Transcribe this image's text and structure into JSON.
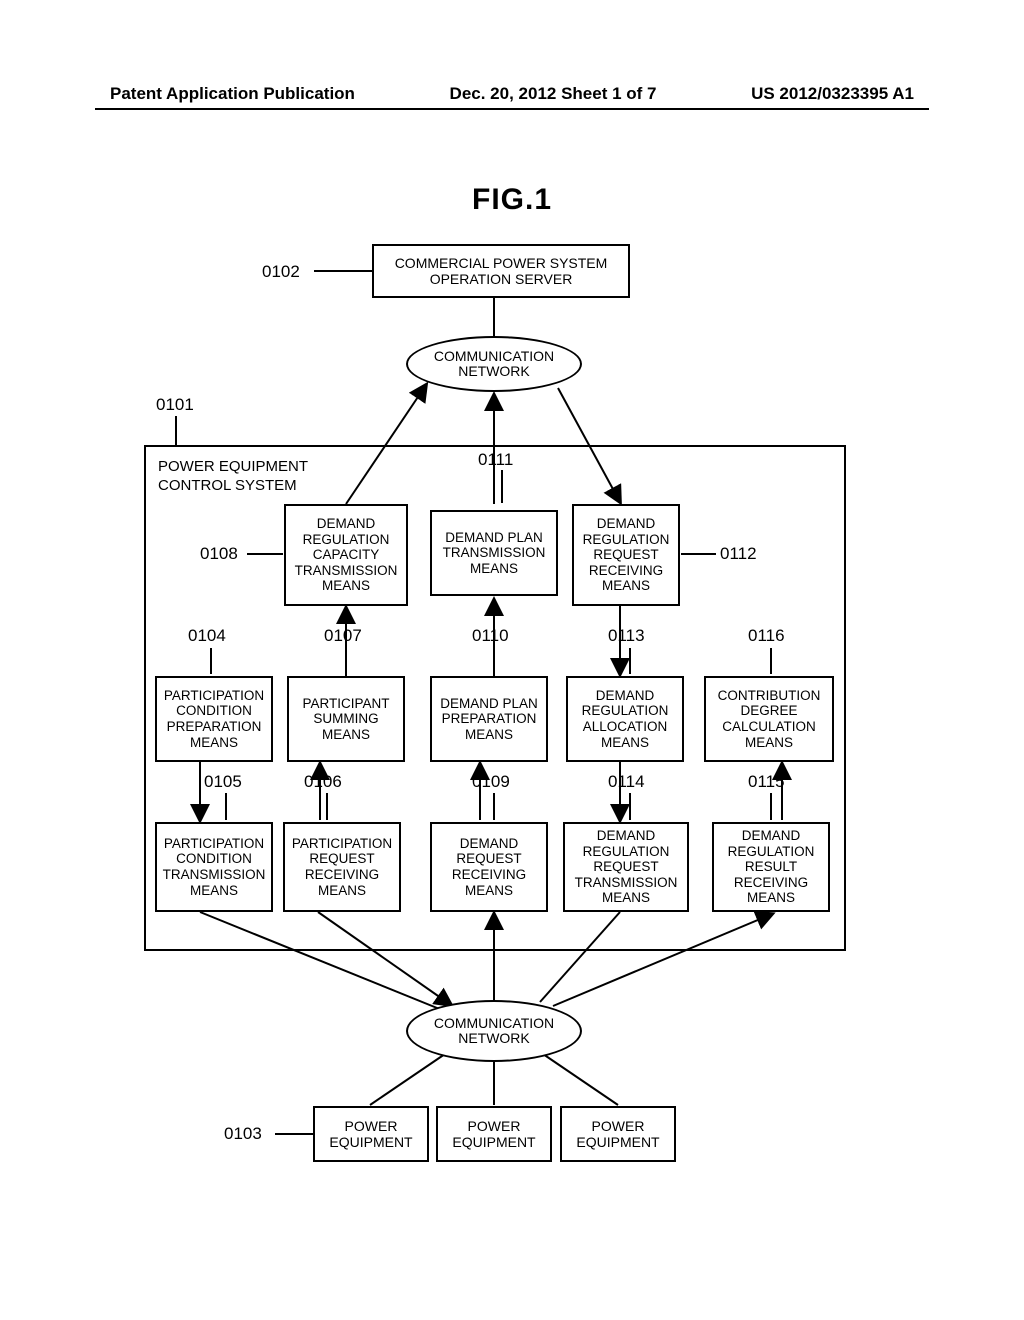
{
  "header": {
    "left": "Patent Application Publication",
    "center": "Dec. 20, 2012  Sheet 1 of 7",
    "right": "US 2012/0323395 A1"
  },
  "fig_title": "FIG.1",
  "top_server": "COMMERCIAL POWER SYSTEM\nOPERATION SERVER",
  "network": "COMMUNICATION\nNETWORK",
  "system_box_title": "POWER EQUIPMENT\nCONTROL SYSTEM",
  "labels": {
    "n0101": "0101",
    "n0102": "0102",
    "n0103": "0103",
    "n0104": "0104",
    "n0105": "0105",
    "n0106": "0106",
    "n0107": "0107",
    "n0108": "0108",
    "n0109": "0109",
    "n0110": "0110",
    "n0111": "0111",
    "n0112": "0112",
    "n0113": "0113",
    "n0114": "0114",
    "n0115": "0115",
    "n0116": "0116"
  },
  "blocks": {
    "b0104": "PARTICIPATION\nCONDITION\nPREPARATION\nMEANS",
    "b0105": "PARTICIPATION\nCONDITION\nTRANSMISSION\nMEANS",
    "b0106": "PARTICIPATION\nREQUEST\nRECEIVING\nMEANS",
    "b0107": "PARTICIPANT\nSUMMING\nMEANS",
    "b0108": "DEMAND\nREGULATION\nCAPACITY\nTRANSMISSION\nMEANS",
    "b0109": "DEMAND\nREQUEST\nRECEIVING\nMEANS",
    "b0110": "DEMAND PLAN\nPREPARATION\nMEANS",
    "b0111": "DEMAND PLAN\nTRANSMISSION\nMEANS",
    "b0112": "DEMAND\nREGULATION\nREQUEST\nRECEIVING\nMEANS",
    "b0113": "DEMAND\nREGULATION\nALLOCATION\nMEANS",
    "b0114": "DEMAND\nREGULATION\nREQUEST\nTRANSMISSION\nMEANS",
    "b0115": "DEMAND\nREGULATION\nRESULT\nRECEIVING\nMEANS",
    "b0116": "CONTRIBUTION\nDEGREE\nCALCULATION\nMEANS"
  },
  "power_equipment": "POWER\nEQUIPMENT"
}
